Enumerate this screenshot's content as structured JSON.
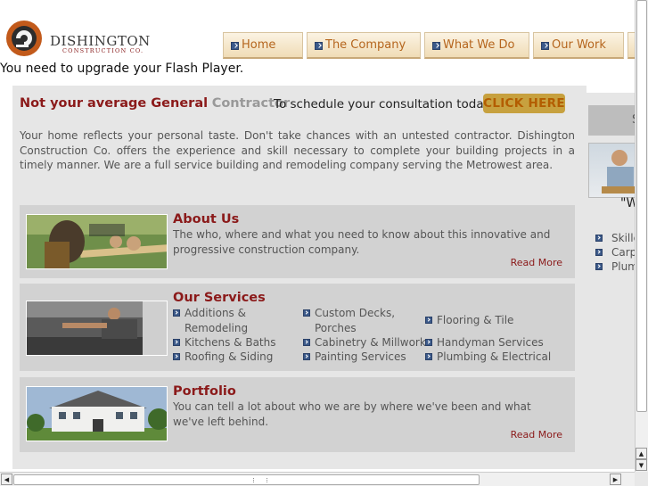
{
  "brand": {
    "name": "DISHINGTON",
    "subtitle": "CONSTRUCTION CO."
  },
  "nav": {
    "items": [
      {
        "label": "Home"
      },
      {
        "label": "The Company"
      },
      {
        "label": "What We Do"
      },
      {
        "label": "Our Work"
      }
    ]
  },
  "flash_message": "You need to upgrade your Flash Player.",
  "headline": {
    "part1": "Not your average General",
    "part2": "Contractor",
    "schedule": "To schedule your consultation today",
    "cta": "CLICK HERE"
  },
  "intro": "Your home reflects your personal taste. Don't take chances with an untested contractor. Dishington Construction Co. offers the experience and skill necessary to complete your building projects in a timely manner. We are a full service building and remodeling company serving the Metrowest area.",
  "cards": {
    "about": {
      "title": "About Us",
      "text": "The who, where and what you need to know about this innovative and progressive construction company.",
      "read_more": "Read More"
    },
    "services": {
      "title": "Our Services",
      "items": [
        "Additions & Remodeling",
        "Kitchens & Baths",
        "Roofing & Siding",
        "Custom Decks, Porches",
        "Cabinetry & Millwork",
        "Painting Services",
        "Flooring & Tile",
        "Handyman Services",
        "Plumbing & Electrical"
      ]
    },
    "portfolio": {
      "title": "Portfolio",
      "text": "You can tell a lot about who we are by where we've been and what we've left behind.",
      "read_more": "Read More"
    }
  },
  "sidebar": {
    "heading_fragment": "S",
    "quote_fragment": "\"W",
    "items": [
      "Skille",
      "Carp",
      "Plum"
    ]
  },
  "colors": {
    "accent_red": "#8b1a1a",
    "nav_text": "#b5651d",
    "cta_bg": "#c7a13f",
    "panel_bg": "#e6e6e6",
    "card_bg": "#d2d2d2",
    "bullet_blue": "#3c5a8a"
  },
  "icons": {
    "logo": "dishington-logo-mark",
    "nav_bullet": "checkbox-arrow-icon",
    "scroll_up": "arrow-up-icon",
    "scroll_down": "arrow-down-icon",
    "scroll_left": "arrow-left-icon",
    "scroll_right": "arrow-right-icon"
  }
}
